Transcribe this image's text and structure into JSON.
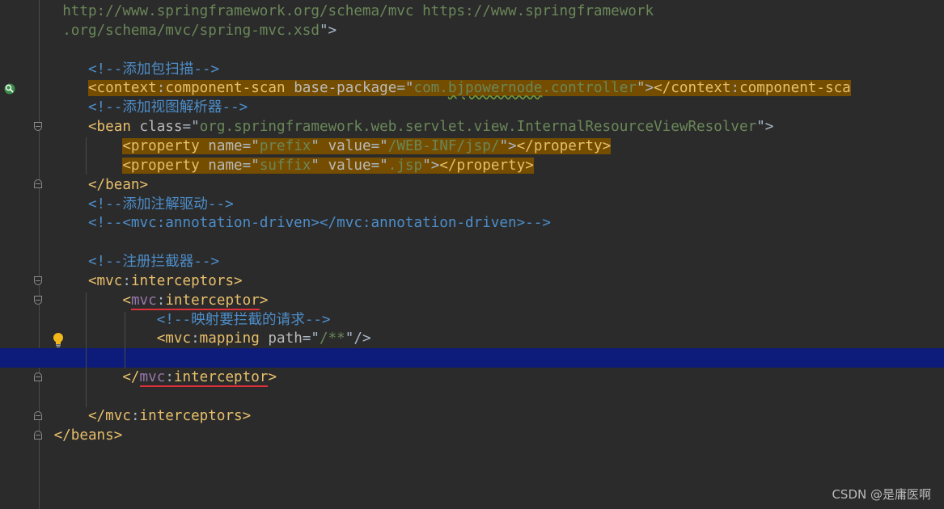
{
  "editor": {
    "lines": [
      {
        "id": "l1",
        "parts": [
          {
            "c": "t-url",
            "t": "http://www.springframework.org/schema/mvc https://www.springframework"
          }
        ],
        "indent": "  "
      },
      {
        "id": "l2",
        "parts": [
          {
            "c": "t-url",
            "t": ".org/schema/mvc/spring-mvc.xsd"
          },
          {
            "c": "t-text",
            "t": "\">"
          }
        ],
        "indent": "  "
      },
      {
        "id": "l3",
        "parts": [],
        "indent": ""
      },
      {
        "id": "l4",
        "parts": [
          {
            "c": "t-cn",
            "t": "<!--添加包扫描-->"
          }
        ],
        "indent": "     "
      },
      {
        "id": "l5",
        "parts": [
          {
            "c": "t-tag hl",
            "t": "<context"
          },
          {
            "c": "t-text hl",
            "t": ":"
          },
          {
            "c": "t-tag hl",
            "t": "component-scan "
          },
          {
            "c": "t-attr hl",
            "t": "base-package"
          },
          {
            "c": "t-text hl",
            "t": "=\""
          },
          {
            "c": "t-val hl",
            "t": "com."
          },
          {
            "c": "t-val hl squig",
            "t": "bjpowernode"
          },
          {
            "c": "t-val hl",
            "t": ".controller"
          },
          {
            "c": "t-text hl",
            "t": "\">"
          },
          {
            "c": "t-tag hl",
            "t": "</context"
          },
          {
            "c": "t-text hl",
            "t": ":"
          },
          {
            "c": "t-tag hl",
            "t": "component-sca"
          }
        ],
        "indent": "     "
      },
      {
        "id": "l6",
        "parts": [
          {
            "c": "t-cn",
            "t": "<!--添加视图解析器-->"
          }
        ],
        "indent": "     "
      },
      {
        "id": "l7",
        "parts": [
          {
            "c": "t-tag",
            "t": "<bean "
          },
          {
            "c": "t-attr",
            "t": "class"
          },
          {
            "c": "t-text",
            "t": "=\""
          },
          {
            "c": "t-val",
            "t": "org.springframework.web.servlet.view.InternalResourceViewResolver"
          },
          {
            "c": "t-text",
            "t": "\">"
          }
        ],
        "indent": "     "
      },
      {
        "id": "l8",
        "parts": [
          {
            "c": "t-tag hl",
            "t": "<property "
          },
          {
            "c": "t-attr hl",
            "t": "name"
          },
          {
            "c": "t-text hl",
            "t": "=\""
          },
          {
            "c": "t-val hl",
            "t": "prefix"
          },
          {
            "c": "t-text hl",
            "t": "\" "
          },
          {
            "c": "t-attr hl",
            "t": "value"
          },
          {
            "c": "t-text hl",
            "t": "=\""
          },
          {
            "c": "t-val hl",
            "t": "/WEB-INF/jsp/"
          },
          {
            "c": "t-text hl",
            "t": "\">"
          },
          {
            "c": "t-tag hl",
            "t": "</property>"
          }
        ],
        "indent": "         "
      },
      {
        "id": "l9",
        "parts": [
          {
            "c": "t-tag hl",
            "t": "<property "
          },
          {
            "c": "t-attr hl",
            "t": "name"
          },
          {
            "c": "t-text hl",
            "t": "=\""
          },
          {
            "c": "t-val hl",
            "t": "suffix"
          },
          {
            "c": "t-text hl",
            "t": "\" "
          },
          {
            "c": "t-attr hl",
            "t": "value"
          },
          {
            "c": "t-text hl",
            "t": "=\""
          },
          {
            "c": "t-val hl",
            "t": ".jsp"
          },
          {
            "c": "t-text hl",
            "t": "\">"
          },
          {
            "c": "t-tag hl",
            "t": "</property>"
          }
        ],
        "indent": "         "
      },
      {
        "id": "l10",
        "parts": [
          {
            "c": "t-tag",
            "t": "</bean>"
          }
        ],
        "indent": "     "
      },
      {
        "id": "l11",
        "parts": [
          {
            "c": "t-cn",
            "t": "<!--添加注解驱动-->"
          }
        ],
        "indent": "     "
      },
      {
        "id": "l12",
        "parts": [
          {
            "c": "t-cn",
            "t": "<!--<mvc:annotation-driven></mvc:annotation-driven>-->"
          }
        ],
        "indent": "     "
      },
      {
        "id": "l13",
        "parts": [],
        "indent": ""
      },
      {
        "id": "l14",
        "parts": [
          {
            "c": "t-cn",
            "t": "<!--注册拦截器-->"
          }
        ],
        "indent": "     "
      },
      {
        "id": "l15",
        "parts": [
          {
            "c": "t-tag",
            "t": "<mvc"
          },
          {
            "c": "t-text",
            "t": ":"
          },
          {
            "c": "t-tag",
            "t": "interceptors>"
          }
        ],
        "indent": "     "
      },
      {
        "id": "l16",
        "parts": [
          {
            "c": "t-tag",
            "t": "<"
          },
          {
            "c": "t-ns redline",
            "t": "mvc"
          },
          {
            "c": "t-text redline",
            "t": ":"
          },
          {
            "c": "t-tag redline",
            "t": "interceptor"
          },
          {
            "c": "t-tag",
            "t": ">"
          }
        ],
        "indent": "         "
      },
      {
        "id": "l17",
        "parts": [
          {
            "c": "t-cn",
            "t": "<!--映射要拦截的请求-->"
          }
        ],
        "indent": "             "
      },
      {
        "id": "l18",
        "parts": [
          {
            "c": "t-tag",
            "t": "<mvc"
          },
          {
            "c": "t-text",
            "t": ":"
          },
          {
            "c": "t-tag",
            "t": "mapping "
          },
          {
            "c": "t-attr",
            "t": "path"
          },
          {
            "c": "t-text",
            "t": "=\""
          },
          {
            "c": "t-val",
            "t": "/**"
          },
          {
            "c": "t-text",
            "t": "\"/>"
          }
        ],
        "indent": "             "
      },
      {
        "id": "l19",
        "parts": [],
        "indent": "",
        "current": true
      },
      {
        "id": "l20",
        "parts": [
          {
            "c": "t-tag",
            "t": "</"
          },
          {
            "c": "t-ns redline",
            "t": "mvc"
          },
          {
            "c": "t-text redline",
            "t": ":"
          },
          {
            "c": "t-tag redline",
            "t": "interceptor"
          },
          {
            "c": "t-tag",
            "t": ">"
          }
        ],
        "indent": "         "
      },
      {
        "id": "l21",
        "parts": [],
        "indent": ""
      },
      {
        "id": "l22",
        "parts": [
          {
            "c": "t-tag",
            "t": "</mvc"
          },
          {
            "c": "t-text",
            "t": ":"
          },
          {
            "c": "t-tag",
            "t": "interceptors>"
          }
        ],
        "indent": "     "
      },
      {
        "id": "l23",
        "parts": [
          {
            "c": "t-tag",
            "t": "</beans>"
          }
        ],
        "indent": " "
      }
    ]
  },
  "watermark": "CSDN @是庸医啊",
  "colors": {
    "background": "#2b2b2b",
    "current_line": "#0d1b7a",
    "highlight": "#754d00",
    "tag": "#e8bf6a",
    "value": "#6a8759",
    "comment": "#4d8dc9"
  }
}
